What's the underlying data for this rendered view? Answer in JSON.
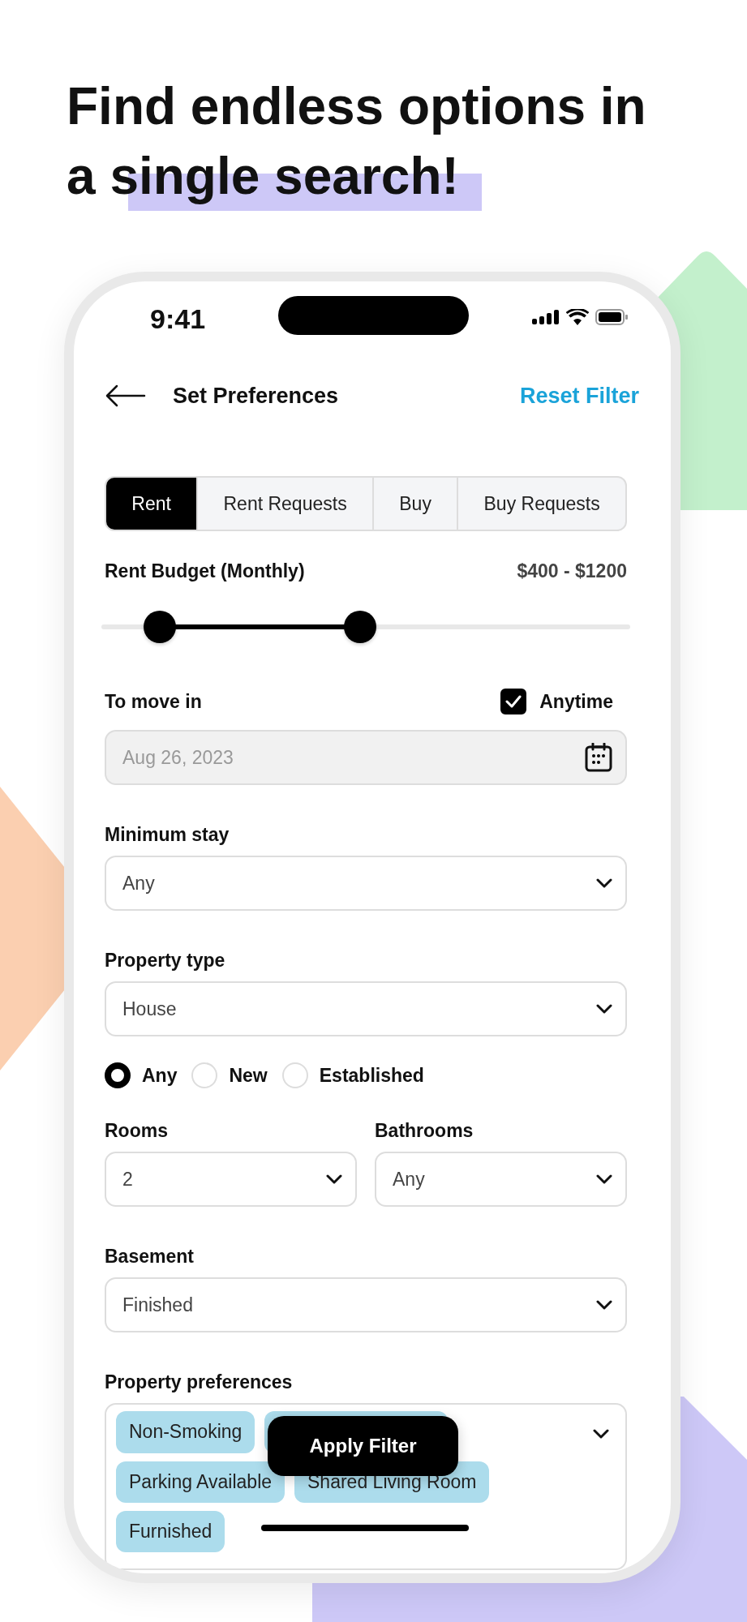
{
  "headline": "Find endless options in a single search!",
  "status_bar": {
    "time": "9:41"
  },
  "header": {
    "title": "Set Preferences",
    "action": "Reset Filter"
  },
  "tabs": [
    {
      "label": "Rent",
      "selected": true
    },
    {
      "label": "Rent Requests",
      "selected": false
    },
    {
      "label": "Buy",
      "selected": false
    },
    {
      "label": "Buy Requests",
      "selected": false
    }
  ],
  "budget": {
    "label": "Rent Budget (Monthly)",
    "range": "$400 - $1200",
    "thumbs": [
      {
        "level": 0.11
      },
      {
        "level": 0.49
      }
    ]
  },
  "move_in": {
    "label": "To move in",
    "checkbox": {
      "label": "Anytime",
      "checked": true
    },
    "date": {
      "value": "Aug 26, 2023",
      "disabled": true
    }
  },
  "sections": [
    {
      "kind": "select",
      "label": "Minimum stay",
      "value": "Any"
    },
    {
      "kind": "select",
      "label": "Property type",
      "value": "House"
    },
    {
      "kind": "radios",
      "options": [
        {
          "label": "Any",
          "selected": true
        },
        {
          "label": "New",
          "selected": false
        },
        {
          "label": "Established",
          "selected": false
        }
      ]
    },
    {
      "kind": "pair",
      "items": [
        {
          "label": "Rooms",
          "value": "2"
        },
        {
          "label": "Bathrooms",
          "value": "Any"
        }
      ]
    },
    {
      "kind": "select",
      "label": "Basement",
      "value": "Finished"
    },
    {
      "kind": "chips",
      "label": "Property preferences",
      "chips": [
        {
          "label": "Non-Smoking",
          "covered": false
        },
        {
          "covered": true
        },
        {
          "label": "Parking Available",
          "covered": false
        },
        {
          "label": "Shared Living Room",
          "covered": false
        },
        {
          "label": "Furnished",
          "covered": false
        }
      ]
    }
  ],
  "apply_button": "Apply Filter"
}
